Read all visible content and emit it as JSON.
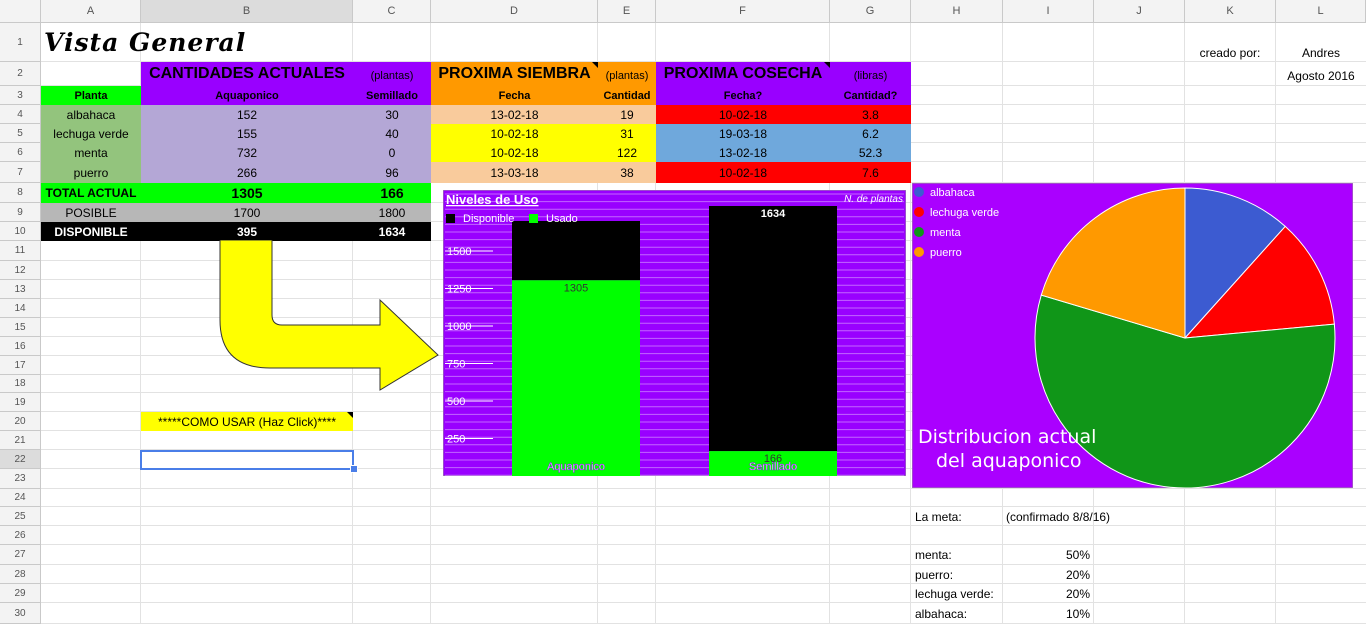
{
  "columns": [
    "A",
    "B",
    "C",
    "D",
    "E",
    "F",
    "G",
    "H",
    "I",
    "J",
    "K",
    "L"
  ],
  "rows": [
    "1",
    "2",
    "3",
    "4",
    "5",
    "6",
    "7",
    "8",
    "9",
    "10",
    "11",
    "12",
    "13",
    "14",
    "15",
    "16",
    "17",
    "18",
    "19",
    "20",
    "21",
    "22",
    "23",
    "24",
    "25",
    "26",
    "27",
    "28",
    "29",
    "30"
  ],
  "sheet": {
    "title": "Vista General",
    "creado_label": "creado por:",
    "author": "Andres",
    "date": "Agosto 2016",
    "cantidades_header": "CANTIDADES ACTUALES",
    "plantas_unit": "(plantas)",
    "siembra_header": "PROXIMA SIEMBRA",
    "siembra_unit": "(plantas)",
    "cosecha_header": "PROXIMA COSECHA",
    "cosecha_unit": "(libras)",
    "col_planta": "Planta",
    "col_aquaponico": "Aquaponico",
    "col_semillado": "Semillado",
    "col_fecha": "Fecha",
    "col_cantidad": "Cantidad",
    "col_fecha_q": "Fecha?",
    "col_cantidad_q": "Cantidad?",
    "plants": [
      {
        "name": "albahaca",
        "aquaponico": "152",
        "semillado": "30",
        "siembra_fecha": "13-02-18",
        "siembra_cant": "19",
        "cosecha_fecha": "10-02-18",
        "cosecha_cant": "3.8"
      },
      {
        "name": "lechuga verde",
        "aquaponico": "155",
        "semillado": "40",
        "siembra_fecha": "10-02-18",
        "siembra_cant": "31",
        "cosecha_fecha": "19-03-18",
        "cosecha_cant": "6.2"
      },
      {
        "name": "menta",
        "aquaponico": "732",
        "semillado": "0",
        "siembra_fecha": "10-02-18",
        "siembra_cant": "122",
        "cosecha_fecha": "13-02-18",
        "cosecha_cant": "52.3"
      },
      {
        "name": "puerro",
        "aquaponico": "266",
        "semillado": "96",
        "siembra_fecha": "13-03-18",
        "siembra_cant": "38",
        "cosecha_fecha": "10-02-18",
        "cosecha_cant": "7.6"
      }
    ],
    "total_label": "TOTAL ACTUAL",
    "total_aquaponico": "1305",
    "total_semillado": "166",
    "posible_label": "POSIBLE",
    "posible_aquaponico": "1700",
    "posible_semillado": "1800",
    "disponible_label": "DISPONIBLE",
    "disponible_aquaponico": "395",
    "disponible_semillado": "1634",
    "como_usar": "*****COMO USAR (Haz Click)****",
    "meta_label": "La meta:",
    "meta_note": "(confirmado 8/8/16)",
    "meta": [
      {
        "label": "menta:",
        "value": "50%"
      },
      {
        "label": "puerro:",
        "value": "20%"
      },
      {
        "label": "lechuga verde:",
        "value": "20%"
      },
      {
        "label": "albahaca:",
        "value": "10%"
      }
    ]
  },
  "colors": {
    "purple": "#9900ff",
    "lightpurple": "#b4a7d6",
    "orange": "#ff9900",
    "lightorange": "#f9cb9c",
    "blue": "#4a86e8",
    "lightblue": "#6fa8dc",
    "red": "#ff0000",
    "yellow": "#ffff00",
    "green": "#00ff00",
    "lightgreen": "#93c47d",
    "gray": "#b7b7b7",
    "black": "#000000"
  },
  "chart_data": [
    {
      "type": "bar",
      "title": "Niveles de Uso",
      "right_label": "N. de plantas",
      "categories": [
        "Aquaponico",
        "Semillado"
      ],
      "series": [
        {
          "name": "Usado",
          "values": [
            1305,
            166
          ],
          "color": "#00ff00"
        },
        {
          "name": "Disponible",
          "values": [
            395,
            1634
          ],
          "color": "#000000"
        }
      ],
      "stacked": true,
      "yticks": [
        250,
        500,
        750,
        1000,
        1250,
        1500
      ],
      "ylim": [
        0,
        1800
      ],
      "legend": "top-left"
    },
    {
      "type": "pie",
      "title": "Distribucion actual del aquaponico",
      "labels": [
        "albahaca",
        "lechuga verde",
        "menta",
        "puerro"
      ],
      "values": [
        152,
        155,
        732,
        266
      ],
      "colors": [
        "#3c5bd1",
        "#ff0000",
        "#109618",
        "#ff9900"
      ],
      "legend": "top-left"
    }
  ]
}
